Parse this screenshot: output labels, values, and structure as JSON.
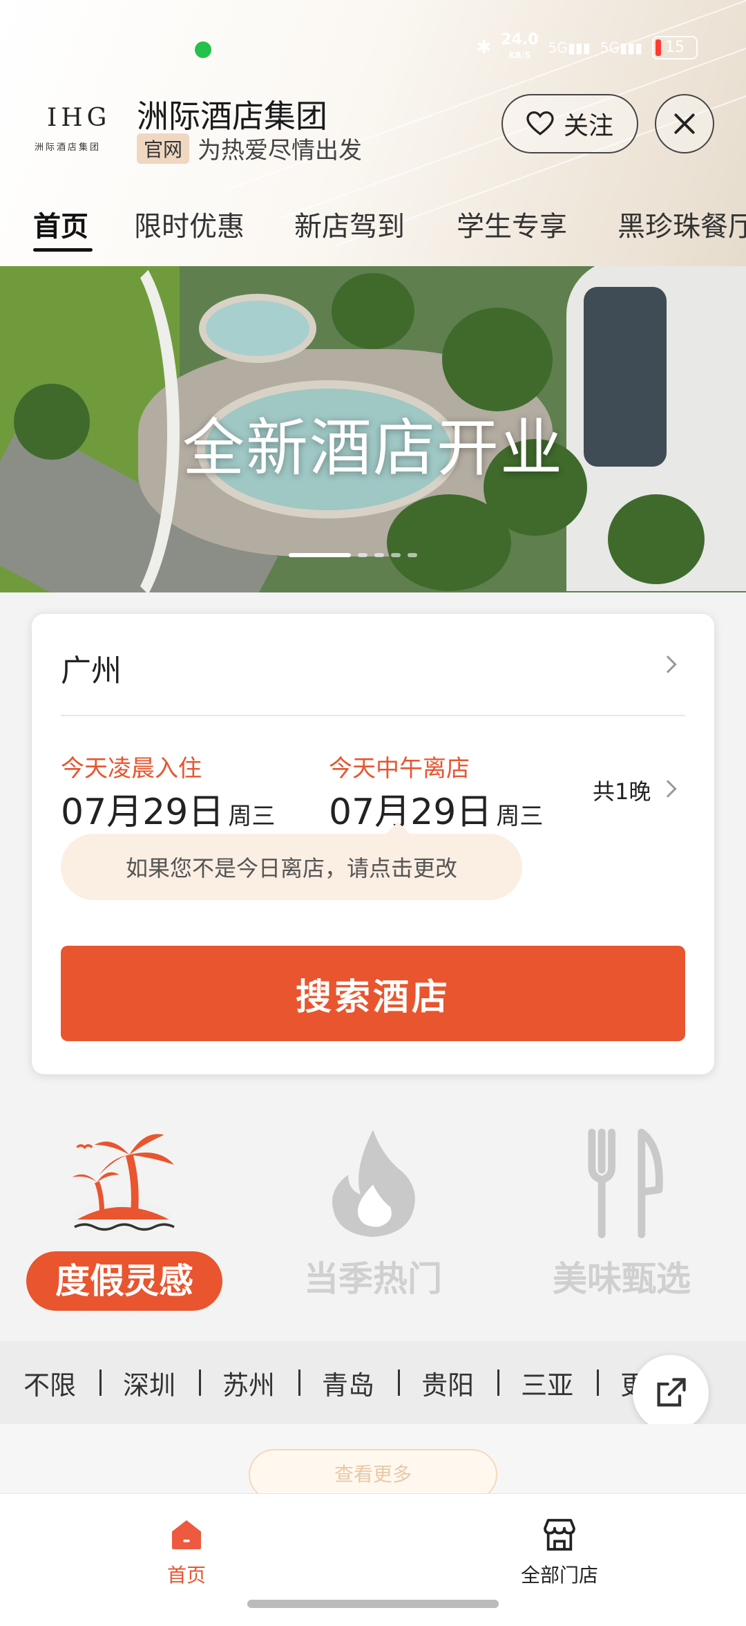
{
  "status_bar": {
    "net_speed": "24.0",
    "net_unit": "KB/S",
    "signal1": "5G",
    "signal2": "5G",
    "battery": "15"
  },
  "header": {
    "logo_text": "IHG",
    "logo_sub": "洲际酒店集团",
    "title": "洲际酒店集团",
    "badge": "官网",
    "slogan": "为热爱尽情出发",
    "follow_label": "关注"
  },
  "tabs": [
    "首页",
    "限时优惠",
    "新店驾到",
    "学生专享",
    "黑珍珠餐厅"
  ],
  "banner": {
    "title": "全新酒店开业",
    "slides": 5,
    "active_slide": 1
  },
  "search": {
    "city": "广州",
    "checkin_label": "今天凌晨入住",
    "checkin_date": "07月29日",
    "checkin_weekday": "周三",
    "checkout_label": "今天中午离店",
    "checkout_date": "07月29日",
    "checkout_weekday": "周三",
    "nights": "共1晚",
    "tip": "如果您不是今日离店，请点击更改",
    "button": "搜索酒店"
  },
  "categories": [
    {
      "label": "度假灵感",
      "icon": "palm-island-icon",
      "active": true
    },
    {
      "label": "当季热门",
      "icon": "flame-icon",
      "active": false
    },
    {
      "label": "美味甄选",
      "icon": "fork-knife-icon",
      "active": false
    }
  ],
  "cities": [
    "不限",
    "深圳",
    "苏州",
    "青岛",
    "贵阳",
    "三亚",
    "更多"
  ],
  "more_button": "查看更多",
  "bottom_nav": [
    {
      "label": "首页",
      "icon": "home-icon",
      "active": true
    },
    {
      "label": "全部门店",
      "icon": "store-icon",
      "active": false
    }
  ],
  "colors": {
    "accent": "#e8552f",
    "tip_bg": "#fbeee3",
    "inactive": "#d0d0d0"
  }
}
